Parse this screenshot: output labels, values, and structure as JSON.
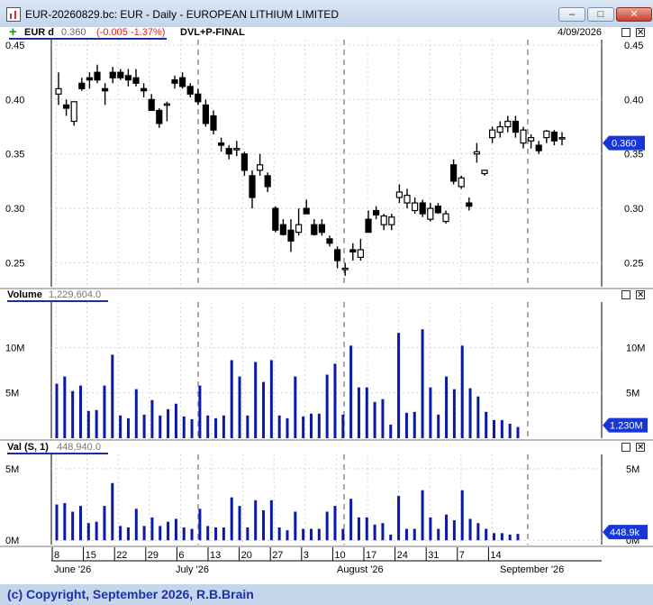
{
  "window": {
    "title": "EUR-20260829.bc: EUR - Daily - EUROPEAN LITHIUM LIMITED",
    "min_glyph": "–",
    "max_glyph": "□",
    "close_glyph": "✕"
  },
  "header": {
    "plus": "+",
    "symbol": "EUR d",
    "last": "0.360",
    "change": "(-0.005 -1.37%)",
    "study": "DVL+P-FINAL",
    "date": "4/09/2026"
  },
  "volume_panel": {
    "title": "Volume",
    "value": "1,229,604.0",
    "last_tag": "1.230M"
  },
  "val_panel": {
    "title": "Val (S, 1)",
    "value": "448,940.0",
    "last_tag": "448.9k"
  },
  "price_tag": "0.360",
  "footer": {
    "copyright": "(c) Copyright, September 2026, R.B.Brain"
  },
  "colors": {
    "volume_bar": "#0a1aa8",
    "price_tag": "#1636d8",
    "label_blue": "#1c2fb0",
    "down": "#e02020"
  },
  "chart_data": [
    {
      "type": "candlestick",
      "panel": "price",
      "yticks": [
        "0.45",
        "0.40",
        "0.35",
        "0.30",
        "0.25"
      ],
      "ytick_values": [
        0.45,
        0.4,
        0.35,
        0.3,
        0.25
      ],
      "ylim": [
        0.228,
        0.455
      ],
      "grid": true,
      "x_tick_labels": [
        "8",
        "15",
        "22",
        "29",
        "6",
        "13",
        "20",
        "27",
        "3",
        "10",
        "17",
        "24",
        "31",
        "7",
        "14"
      ],
      "month_labels": [
        "June '26",
        "July '26",
        "August '26",
        "September '26"
      ],
      "candles": [
        {
          "o": 0.405,
          "h": 0.425,
          "l": 0.395,
          "c": 0.41
        },
        {
          "o": 0.395,
          "h": 0.4,
          "l": 0.385,
          "c": 0.392
        },
        {
          "o": 0.38,
          "h": 0.398,
          "l": 0.376,
          "c": 0.398
        },
        {
          "o": 0.415,
          "h": 0.42,
          "l": 0.408,
          "c": 0.41
        },
        {
          "o": 0.42,
          "h": 0.425,
          "l": 0.41,
          "c": 0.418
        },
        {
          "o": 0.425,
          "h": 0.432,
          "l": 0.415,
          "c": 0.418
        },
        {
          "o": 0.41,
          "h": 0.415,
          "l": 0.395,
          "c": 0.408
        },
        {
          "o": 0.425,
          "h": 0.43,
          "l": 0.415,
          "c": 0.42
        },
        {
          "o": 0.425,
          "h": 0.428,
          "l": 0.418,
          "c": 0.42
        },
        {
          "o": 0.422,
          "h": 0.428,
          "l": 0.412,
          "c": 0.418
        },
        {
          "o": 0.42,
          "h": 0.428,
          "l": 0.412,
          "c": 0.415
        },
        {
          "o": 0.41,
          "h": 0.415,
          "l": 0.402,
          "c": 0.408
        },
        {
          "o": 0.4,
          "h": 0.405,
          "l": 0.39,
          "c": 0.39
        },
        {
          "o": 0.39,
          "h": 0.392,
          "l": 0.374,
          "c": 0.378
        },
        {
          "o": 0.396,
          "h": 0.398,
          "l": 0.38,
          "c": 0.396
        },
        {
          "o": 0.418,
          "h": 0.422,
          "l": 0.41,
          "c": 0.415
        },
        {
          "o": 0.42,
          "h": 0.425,
          "l": 0.41,
          "c": 0.412
        },
        {
          "o": 0.412,
          "h": 0.415,
          "l": 0.402,
          "c": 0.405
        },
        {
          "o": 0.405,
          "h": 0.41,
          "l": 0.395,
          "c": 0.398
        },
        {
          "o": 0.395,
          "h": 0.4,
          "l": 0.375,
          "c": 0.378
        },
        {
          "o": 0.385,
          "h": 0.39,
          "l": 0.368,
          "c": 0.372
        },
        {
          "o": 0.36,
          "h": 0.365,
          "l": 0.352,
          "c": 0.358
        },
        {
          "o": 0.355,
          "h": 0.358,
          "l": 0.345,
          "c": 0.35
        },
        {
          "o": 0.355,
          "h": 0.362,
          "l": 0.348,
          "c": 0.355
        },
        {
          "o": 0.35,
          "h": 0.352,
          "l": 0.33,
          "c": 0.335
        },
        {
          "o": 0.33,
          "h": 0.335,
          "l": 0.3,
          "c": 0.31
        },
        {
          "o": 0.335,
          "h": 0.35,
          "l": 0.33,
          "c": 0.34
        },
        {
          "o": 0.33,
          "h": 0.333,
          "l": 0.315,
          "c": 0.32
        },
        {
          "o": 0.3,
          "h": 0.302,
          "l": 0.278,
          "c": 0.28
        },
        {
          "o": 0.285,
          "h": 0.29,
          "l": 0.275,
          "c": 0.276
        },
        {
          "o": 0.28,
          "h": 0.29,
          "l": 0.26,
          "c": 0.27
        },
        {
          "o": 0.278,
          "h": 0.3,
          "l": 0.275,
          "c": 0.285
        },
        {
          "o": 0.3,
          "h": 0.308,
          "l": 0.295,
          "c": 0.295
        },
        {
          "o": 0.285,
          "h": 0.29,
          "l": 0.275,
          "c": 0.276
        },
        {
          "o": 0.285,
          "h": 0.29,
          "l": 0.275,
          "c": 0.278
        },
        {
          "o": 0.272,
          "h": 0.275,
          "l": 0.265,
          "c": 0.268
        },
        {
          "o": 0.262,
          "h": 0.265,
          "l": 0.245,
          "c": 0.252
        },
        {
          "o": 0.245,
          "h": 0.25,
          "l": 0.238,
          "c": 0.245
        },
        {
          "o": 0.262,
          "h": 0.268,
          "l": 0.252,
          "c": 0.26
        },
        {
          "o": 0.255,
          "h": 0.272,
          "l": 0.252,
          "c": 0.262
        },
        {
          "o": 0.29,
          "h": 0.298,
          "l": 0.285,
          "c": 0.278
        },
        {
          "o": 0.298,
          "h": 0.302,
          "l": 0.29,
          "c": 0.294
        },
        {
          "o": 0.285,
          "h": 0.295,
          "l": 0.28,
          "c": 0.293
        },
        {
          "o": 0.285,
          "h": 0.295,
          "l": 0.28,
          "c": 0.292
        },
        {
          "o": 0.31,
          "h": 0.322,
          "l": 0.305,
          "c": 0.315
        },
        {
          "o": 0.305,
          "h": 0.318,
          "l": 0.3,
          "c": 0.312
        },
        {
          "o": 0.298,
          "h": 0.31,
          "l": 0.295,
          "c": 0.305
        },
        {
          "o": 0.305,
          "h": 0.308,
          "l": 0.292,
          "c": 0.295
        },
        {
          "o": 0.29,
          "h": 0.305,
          "l": 0.288,
          "c": 0.3
        },
        {
          "o": 0.302,
          "h": 0.305,
          "l": 0.295,
          "c": 0.296
        },
        {
          "o": 0.288,
          "h": 0.298,
          "l": 0.286,
          "c": 0.295
        },
        {
          "o": 0.34,
          "h": 0.345,
          "l": 0.322,
          "c": 0.325
        },
        {
          "o": 0.32,
          "h": 0.33,
          "l": 0.318,
          "c": 0.328
        },
        {
          "o": 0.305,
          "h": 0.31,
          "l": 0.298,
          "c": 0.302
        },
        {
          "o": 0.35,
          "h": 0.36,
          "l": 0.342,
          "c": 0.352
        },
        {
          "o": 0.332,
          "h": 0.335,
          "l": 0.33,
          "c": 0.335
        },
        {
          "o": 0.365,
          "h": 0.375,
          "l": 0.36,
          "c": 0.372
        },
        {
          "o": 0.37,
          "h": 0.38,
          "l": 0.365,
          "c": 0.375
        },
        {
          "o": 0.375,
          "h": 0.385,
          "l": 0.37,
          "c": 0.38
        },
        {
          "o": 0.38,
          "h": 0.385,
          "l": 0.365,
          "c": 0.37
        },
        {
          "o": 0.36,
          "h": 0.375,
          "l": 0.355,
          "c": 0.372
        },
        {
          "o": 0.362,
          "h": 0.368,
          "l": 0.355,
          "c": 0.365
        },
        {
          "o": 0.358,
          "h": 0.362,
          "l": 0.35,
          "c": 0.353
        },
        {
          "o": 0.365,
          "h": 0.372,
          "l": 0.36,
          "c": 0.371
        },
        {
          "o": 0.37,
          "h": 0.372,
          "l": 0.358,
          "c": 0.362
        },
        {
          "o": 0.365,
          "h": 0.37,
          "l": 0.358,
          "c": 0.365
        }
      ]
    },
    {
      "type": "bar",
      "panel": "volume",
      "name": "Volume",
      "yticks": [
        "10M",
        "5M"
      ],
      "ytick_values": [
        10000000,
        5000000
      ],
      "ylim": [
        0,
        15000000
      ],
      "values": [
        6.0,
        6.8,
        5.2,
        5.8,
        3.0,
        3.1,
        5.8,
        9.2,
        2.5,
        2.2,
        5.4,
        2.6,
        4.2,
        2.5,
        3.2,
        3.8,
        2.4,
        2.1,
        5.8,
        2.5,
        2.2,
        2.5,
        8.6,
        6.8,
        2.5,
        8.4,
        6.2,
        8.6,
        2.5,
        2.2,
        6.8,
        2.4,
        2.7,
        2.7,
        7.0,
        8.2,
        2.6,
        10.2,
        5.6,
        5.6,
        4.0,
        4.3,
        1.5,
        11.6,
        2.8,
        2.9,
        12.0,
        5.6,
        2.6,
        6.8,
        5.4,
        10.2,
        5.5,
        4.6,
        2.9,
        2.0,
        2.0,
        1.6,
        1.23
      ],
      "unit_millions": true
    },
    {
      "type": "bar",
      "panel": "val",
      "name": "Val (S, 1)",
      "yticks": [
        "5M",
        "0M"
      ],
      "ytick_values": [
        5000000,
        0
      ],
      "ylim": [
        -300000,
        6000000
      ],
      "values": [
        2.5,
        2.6,
        2.0,
        2.4,
        1.2,
        1.3,
        2.4,
        4.0,
        1.0,
        0.9,
        2.2,
        1.0,
        1.6,
        1.0,
        1.3,
        1.5,
        0.9,
        0.8,
        2.2,
        1.0,
        0.9,
        0.9,
        3.0,
        2.4,
        0.9,
        2.8,
        2.1,
        2.8,
        0.9,
        0.7,
        2.0,
        0.8,
        0.8,
        0.8,
        2.0,
        2.4,
        0.8,
        2.9,
        1.6,
        1.6,
        1.1,
        1.2,
        0.4,
        3.1,
        0.8,
        0.8,
        3.5,
        1.6,
        0.8,
        1.8,
        1.4,
        3.5,
        1.5,
        1.2,
        0.8,
        0.5,
        0.5,
        0.4,
        0.449
      ],
      "unit_millions": true
    }
  ]
}
